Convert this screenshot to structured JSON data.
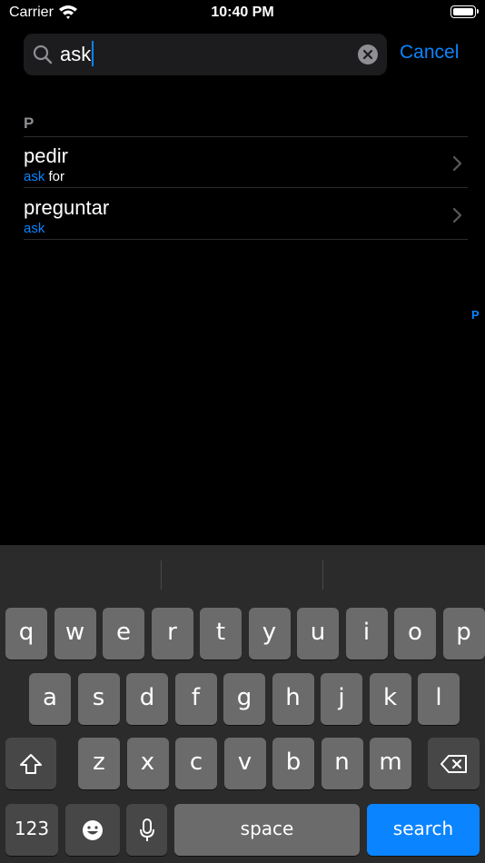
{
  "status_bar": {
    "carrier": "Carrier",
    "time": "10:40 PM"
  },
  "search": {
    "query": "ask",
    "cancel_label": "Cancel"
  },
  "results": {
    "section_letter": "P",
    "index_letter": "P",
    "items": [
      {
        "title": "pedir",
        "highlight": "ask",
        "rest": " for"
      },
      {
        "title": "preguntar",
        "highlight": "ask",
        "rest": ""
      }
    ]
  },
  "keyboard": {
    "row1": [
      "q",
      "w",
      "e",
      "r",
      "t",
      "y",
      "u",
      "i",
      "o",
      "p"
    ],
    "row2": [
      "a",
      "s",
      "d",
      "f",
      "g",
      "h",
      "j",
      "k",
      "l"
    ],
    "row3": [
      "z",
      "x",
      "c",
      "v",
      "b",
      "n",
      "m"
    ],
    "numbers_label": "123",
    "space_label": "space",
    "search_label": "search"
  },
  "colors": {
    "accent": "#0a84ff",
    "key": "#6b6b6b",
    "key_dark": "#474747",
    "keyboard_bg": "#2b2b2b"
  }
}
